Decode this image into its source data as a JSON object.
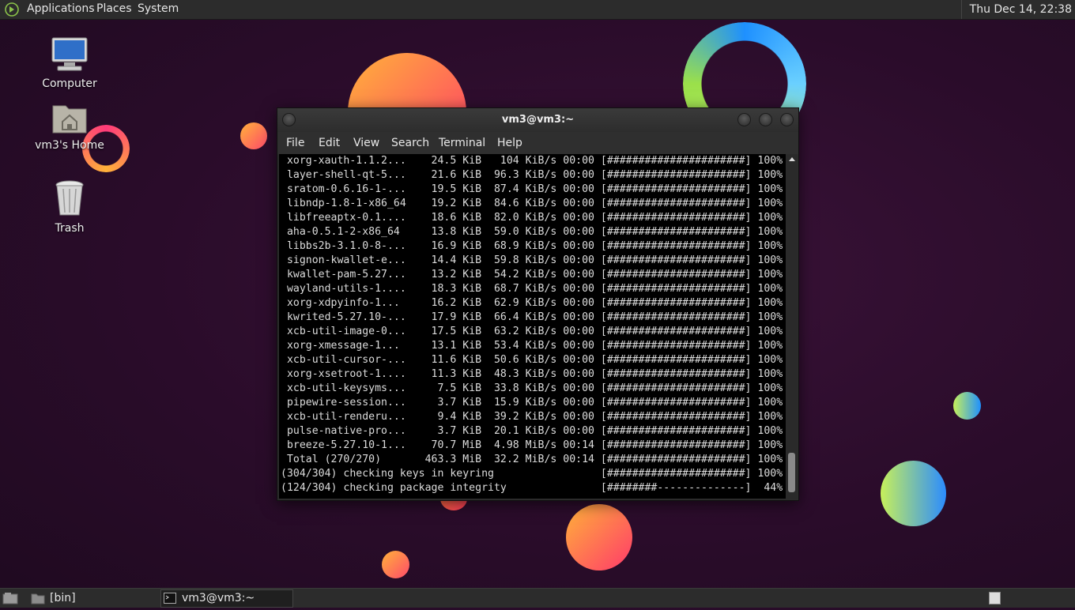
{
  "top_panel": {
    "menus": [
      "Applications",
      "Places",
      "System"
    ],
    "clock": "Thu Dec 14, 22:38"
  },
  "desktop": {
    "icons": [
      {
        "label": "Computer",
        "icon": "computer-icon"
      },
      {
        "label": "vm3's Home",
        "icon": "home-folder-icon"
      },
      {
        "label": "Trash",
        "icon": "trash-icon"
      }
    ]
  },
  "window": {
    "title": "vm3@vm3:~",
    "menu": [
      "File",
      "Edit",
      "View",
      "Search",
      "Terminal",
      "Help"
    ],
    "lines": [
      " xorg-xauth-1.1.2...    24.5 KiB   104 KiB/s 00:00 [######################] 100%",
      " layer-shell-qt-5...    21.6 KiB  96.3 KiB/s 00:00 [######################] 100%",
      " sratom-0.6.16-1-...    19.5 KiB  87.4 KiB/s 00:00 [######################] 100%",
      " libndp-1.8-1-x86_64    19.2 KiB  84.6 KiB/s 00:00 [######################] 100%",
      " libfreeaptx-0.1....    18.6 KiB  82.0 KiB/s 00:00 [######################] 100%",
      " aha-0.5.1-2-x86_64     13.8 KiB  59.0 KiB/s 00:00 [######################] 100%",
      " libbs2b-3.1.0-8-...    16.9 KiB  68.9 KiB/s 00:00 [######################] 100%",
      " signon-kwallet-e...    14.4 KiB  59.8 KiB/s 00:00 [######################] 100%",
      " kwallet-pam-5.27...    13.2 KiB  54.2 KiB/s 00:00 [######################] 100%",
      " wayland-utils-1....    18.3 KiB  68.7 KiB/s 00:00 [######################] 100%",
      " xorg-xdpyinfo-1...     16.2 KiB  62.9 KiB/s 00:00 [######################] 100%",
      " kwrited-5.27.10-...    17.9 KiB  66.4 KiB/s 00:00 [######################] 100%",
      " xcb-util-image-0...    17.5 KiB  63.2 KiB/s 00:00 [######################] 100%",
      " xorg-xmessage-1...     13.1 KiB  53.4 KiB/s 00:00 [######################] 100%",
      " xcb-util-cursor-...    11.6 KiB  50.6 KiB/s 00:00 [######################] 100%",
      " xorg-xsetroot-1....    11.3 KiB  48.3 KiB/s 00:00 [######################] 100%",
      " xcb-util-keysyms...     7.5 KiB  33.8 KiB/s 00:00 [######################] 100%",
      " pipewire-session...     3.7 KiB  15.9 KiB/s 00:00 [######################] 100%",
      " xcb-util-renderu...     9.4 KiB  39.2 KiB/s 00:00 [######################] 100%",
      " pulse-native-pro...     3.7 KiB  20.1 KiB/s 00:00 [######################] 100%",
      " breeze-5.27.10-1...    70.7 MiB  4.98 MiB/s 00:14 [######################] 100%",
      " Total (270/270)       463.3 MiB  32.2 MiB/s 00:14 [######################] 100%",
      "(304/304) checking keys in keyring                 [######################] 100%",
      "(124/304) checking package integrity               [########--------------]  44%"
    ]
  },
  "bottom_panel": {
    "tasks": [
      {
        "label": "[bin]",
        "icon": "folder-icon"
      },
      {
        "label": "vm3@vm3:~",
        "icon": "terminal-icon"
      }
    ]
  },
  "colors": {
    "panel": "#2c2c2c",
    "desktop_bg": "#2a0c2a"
  }
}
